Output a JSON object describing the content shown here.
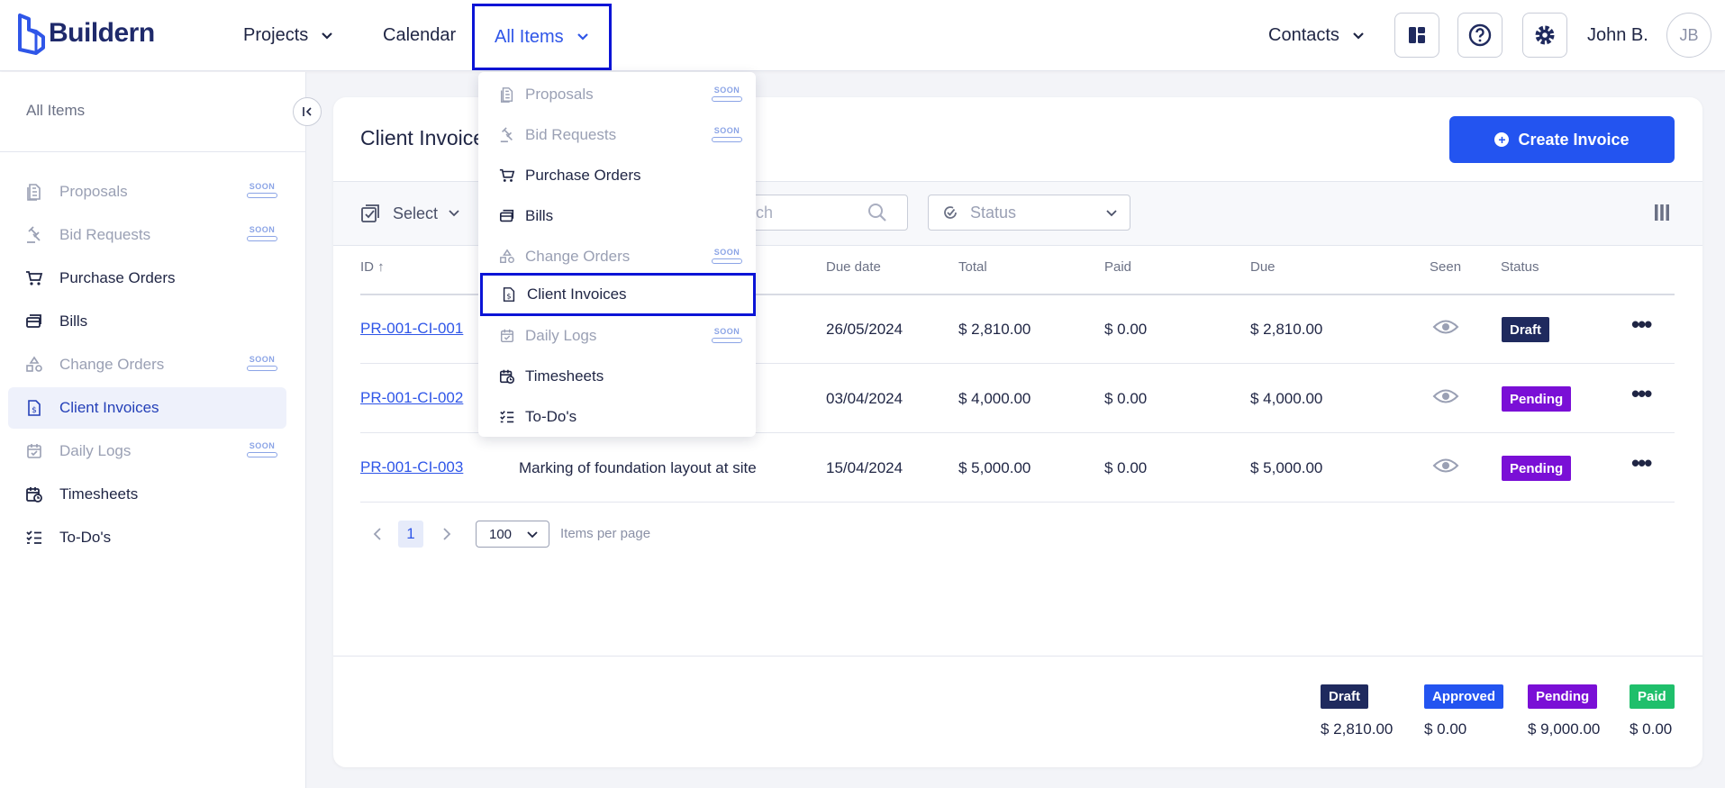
{
  "app": {
    "brand": "Buildern"
  },
  "nav": {
    "projects": "Projects",
    "calendar": "Calendar",
    "all_items": "All Items",
    "contacts": "Contacts",
    "username": "John B.",
    "avatar_initials": "JB"
  },
  "sidebar": {
    "title": "All Items",
    "items": [
      {
        "label": "Proposals",
        "badge": "SOON",
        "icon": "proposal-icon"
      },
      {
        "label": "Bid Requests",
        "badge": "SOON",
        "icon": "gavel-icon"
      },
      {
        "label": "Purchase Orders",
        "icon": "cart-icon"
      },
      {
        "label": "Bills",
        "icon": "bills-icon"
      },
      {
        "label": "Change Orders",
        "badge": "SOON",
        "icon": "shapes-icon"
      },
      {
        "label": "Client Invoices",
        "icon": "invoice-icon"
      },
      {
        "label": "Daily Logs",
        "badge": "SOON",
        "icon": "calendar-check-icon"
      },
      {
        "label": "Timesheets",
        "icon": "timesheet-icon"
      },
      {
        "label": "To-Do's",
        "icon": "checklist-icon"
      }
    ]
  },
  "dropdown": {
    "items": [
      {
        "label": "Proposals",
        "badge": "SOON"
      },
      {
        "label": "Bid Requests",
        "badge": "SOON"
      },
      {
        "label": "Purchase Orders"
      },
      {
        "label": "Bills"
      },
      {
        "label": "Change Orders",
        "badge": "SOON"
      },
      {
        "label": "Client Invoices"
      },
      {
        "label": "Daily Logs",
        "badge": "SOON"
      },
      {
        "label": "Timesheets"
      },
      {
        "label": "To-Do's"
      }
    ]
  },
  "main": {
    "title": "Client Invoices",
    "create_button": "Create Invoice",
    "select_label": "Select",
    "search_placeholder": "Search",
    "status_placeholder": "Status",
    "columns": {
      "id": "ID",
      "due_date": "Due date",
      "total": "Total",
      "paid": "Paid",
      "due": "Due",
      "seen": "Seen",
      "status": "Status"
    },
    "rows": [
      {
        "id": "PR-001-CI-001",
        "description": "",
        "due_date": "26/05/2024",
        "total": "$ 2,810.00",
        "paid": "$ 0.00",
        "due": "$ 2,810.00",
        "status": "Draft"
      },
      {
        "id": "PR-001-CI-002",
        "description": "",
        "due_date": "03/04/2024",
        "total": "$ 4,000.00",
        "paid": "$ 0.00",
        "due": "$ 4,000.00",
        "status": "Pending"
      },
      {
        "id": "PR-001-CI-003",
        "description": "Marking of foundation layout at site",
        "due_date": "15/04/2024",
        "total": "$ 5,000.00",
        "paid": "$ 0.00",
        "due": "$ 5,000.00",
        "status": "Pending"
      }
    ],
    "pagination": {
      "current_page": "1",
      "per_page": "100",
      "per_page_label": "Items per page"
    },
    "summary": [
      {
        "label": "Draft",
        "value": "$ 2,810.00",
        "color": "#1f2a5e"
      },
      {
        "label": "Approved",
        "value": "$ 0.00",
        "color": "#2354f0"
      },
      {
        "label": "Pending",
        "value": "$ 9,000.00",
        "color": "#7a0fd6"
      },
      {
        "label": "Paid",
        "value": "$ 0.00",
        "color": "#1fbf6b"
      }
    ]
  },
  "colors": {
    "accent": "#2354f0",
    "highlight_border": "#0b14d6",
    "draft": "#1f2a5e",
    "pending": "#7a0fd6"
  }
}
